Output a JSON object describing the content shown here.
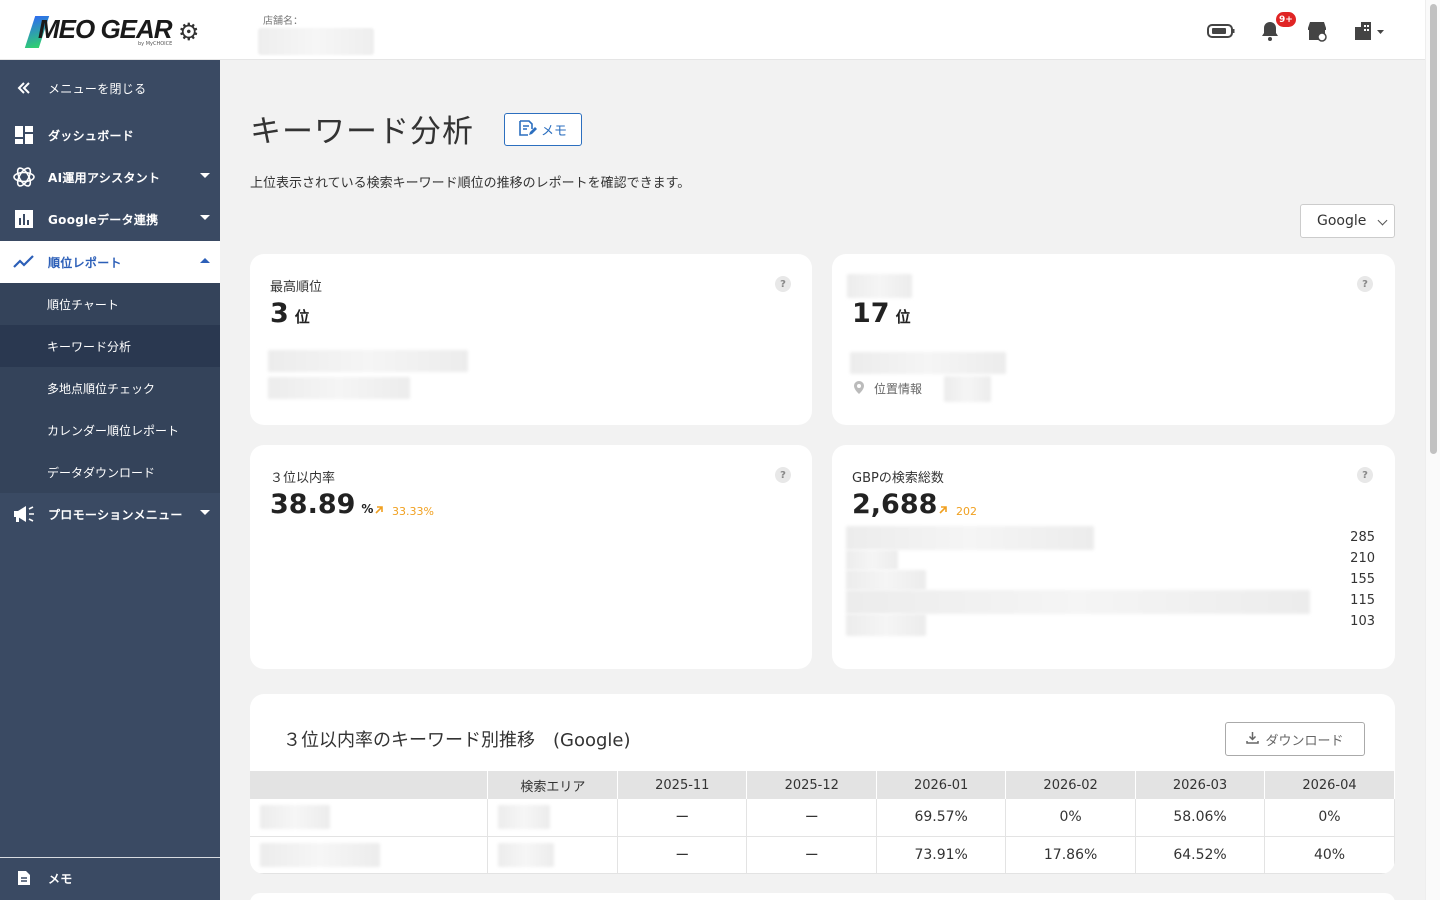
{
  "header": {
    "logo_text": "MEO GEAR",
    "logo_sub": "by MyCHOICE",
    "store_label": "店舗名：",
    "notification_badge": "9+"
  },
  "sidebar": {
    "close_label": "メニューを閉じる",
    "items": [
      {
        "label": "ダッシュボード",
        "icon": "dashboard-icon"
      },
      {
        "label": "AI運用アシスタント",
        "icon": "openai-icon"
      },
      {
        "label": "Googleデータ連携",
        "icon": "bar-chart-icon"
      },
      {
        "label": "順位レポート",
        "icon": "trend-icon"
      },
      {
        "label": "プロモーションメニュー",
        "icon": "megaphone-icon"
      }
    ],
    "sub_items": [
      "順位チャート",
      "キーワード分析",
      "多地点順位チェック",
      "カレンダー順位レポート",
      "データダウンロード"
    ],
    "memo_label": "メモ"
  },
  "page": {
    "title": "キーワード分析",
    "memo_button": "メモ",
    "description": "上位表示されている検索キーワード順位の推移のレポートを確認できます。",
    "engine_select": "Google"
  },
  "cards": {
    "best_rank": {
      "label": "最高順位",
      "value": "3",
      "unit": "位"
    },
    "second_rank": {
      "value": "17",
      "unit": "位",
      "location_label": "位置情報"
    },
    "top3_rate": {
      "label": "３位以内率",
      "value": "38.89",
      "unit": "%",
      "delta": "33.33%"
    },
    "gbp_total": {
      "label": "GBPの検索総数",
      "value": "2,688",
      "delta": "202",
      "bars": [
        "285",
        "210",
        "155",
        "115",
        "103"
      ]
    }
  },
  "table_section": {
    "title": "３位以内率のキーワード別推移　(Google)",
    "download_label": "ダウンロード",
    "columns": [
      "",
      "検索エリア",
      "2025-11",
      "2025-12",
      "2026-01",
      "2026-02",
      "2026-03",
      "2026-04"
    ],
    "rows": [
      {
        "values": [
          "ー",
          "ー",
          "69.57%",
          "0%",
          "58.06%",
          "0%"
        ]
      },
      {
        "values": [
          "ー",
          "ー",
          "73.91%",
          "17.86%",
          "64.52%",
          "40%"
        ]
      }
    ]
  },
  "colors": {
    "sidebar_bg": "#3a4a63",
    "accent": "#2c6fbf",
    "delta_orange": "#f0a020",
    "badge_red": "#e02424"
  }
}
